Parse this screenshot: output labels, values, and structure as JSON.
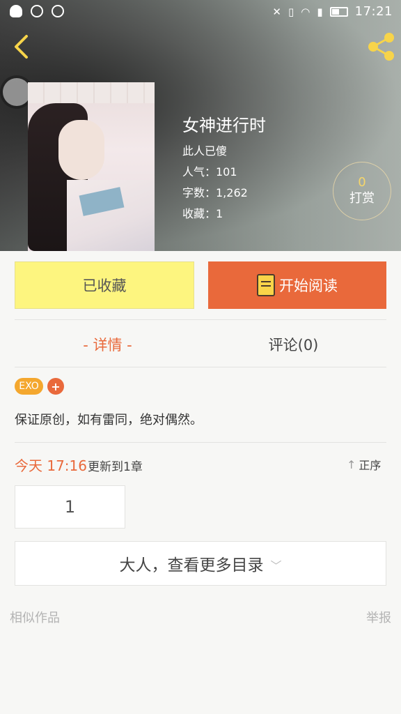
{
  "status_bar": {
    "time": "17:21",
    "icons": [
      "qq-icon",
      "qq-chat-icon",
      "message-icon",
      "mute-icon",
      "vibrate-off-icon",
      "wifi-icon",
      "signal-icon",
      "battery-icon"
    ]
  },
  "header": {
    "back_icon": "back-chevron-icon",
    "share_icon": "share-icon"
  },
  "book": {
    "title": "女神进行时",
    "author": "此人已傻",
    "popularity": "人气：101",
    "word_count": "字数：1,262",
    "favorites": "收藏：1"
  },
  "tip": {
    "count": "0",
    "label": "打赏"
  },
  "actions": {
    "favorite_label": "已收藏",
    "read_label": "开始阅读"
  },
  "tabs": [
    {
      "label": "- 详情 -",
      "active": true
    },
    {
      "label": "评论(0)",
      "active": false
    }
  ],
  "tags": {
    "items": [
      "EXO"
    ],
    "add_label": "+"
  },
  "description": "保证原创，如有雷同，绝对偶然。",
  "update": {
    "time": "今天 17:16",
    "text": "更新到1章",
    "sort_label": "正序"
  },
  "chapters": [
    "1"
  ],
  "more_toc_label": "大人，查看更多目录",
  "footer": {
    "similar_label": "相似作品",
    "report_label": "举报"
  },
  "colors": {
    "accent": "#e9693b",
    "favorite_bg": "#fdf57f",
    "tag_exo": "#f4a72e",
    "tip_count": "#f6d66b"
  }
}
